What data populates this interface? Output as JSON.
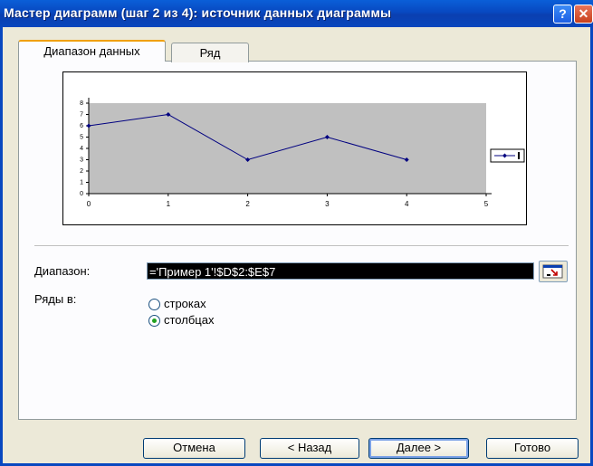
{
  "window": {
    "title": "Мастер диаграмм (шаг 2 из 4): источник данных диаграммы",
    "help_label": "?",
    "close_label": "✕"
  },
  "tabs": [
    {
      "label": "Диапазон данных",
      "active": true
    },
    {
      "label": "Ряд",
      "active": false
    }
  ],
  "chart_data": {
    "type": "line",
    "title": "",
    "x": [
      0,
      1,
      2,
      3,
      4
    ],
    "series": [
      {
        "name": "",
        "values": [
          6,
          7,
          3,
          5,
          3
        ],
        "color": "#000080"
      }
    ],
    "xlim": [
      0,
      5
    ],
    "ylim": [
      0,
      8
    ],
    "xticks": [
      0,
      1,
      2,
      3,
      4,
      5
    ],
    "yticks": [
      0,
      1,
      2,
      3,
      4,
      5,
      6,
      7,
      8
    ],
    "plot_background": "#c0c0c0",
    "legend_position": "right",
    "grid": false
  },
  "range": {
    "label": "Диапазон:",
    "value": "='Пример 1'!$D$2:$E$7"
  },
  "series_in": {
    "label": "Ряды в:",
    "options": [
      {
        "label": "строках",
        "selected": false
      },
      {
        "label": "столбцах",
        "selected": true
      }
    ]
  },
  "buttons": {
    "cancel": "Отмена",
    "back": "< Назад",
    "next": "Далее >",
    "finish": "Готово"
  }
}
